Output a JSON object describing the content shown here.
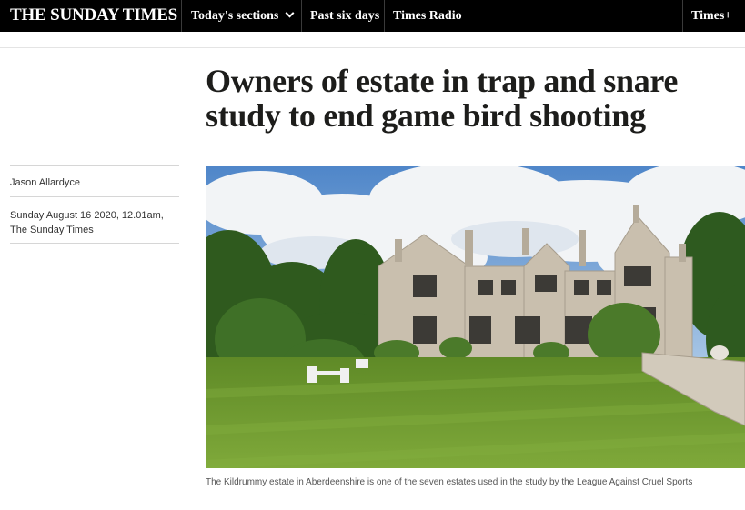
{
  "header": {
    "logo": "THE SUNDAY TIMES",
    "nav": {
      "sections": "Today's sections",
      "past": "Past six days",
      "radio": "Times Radio",
      "plus": "Times+"
    }
  },
  "article": {
    "headline_line1": "Owners of estate in trap and snare",
    "headline_line2": "study to end game bird shooting",
    "author": "Jason Allardyce",
    "date": "Sunday August 16 2020, 12.01am,",
    "publication": "The Sunday Times",
    "image_caption": "The Kildrummy estate in Aberdeenshire is one of the seven estates used in the study by the League Against Cruel Sports"
  },
  "colors": {
    "nav_bg": "#000000",
    "text": "#1d1d1b",
    "caption": "#555555",
    "stone": "#c9bfae",
    "lawn": "#6f9a2e"
  }
}
